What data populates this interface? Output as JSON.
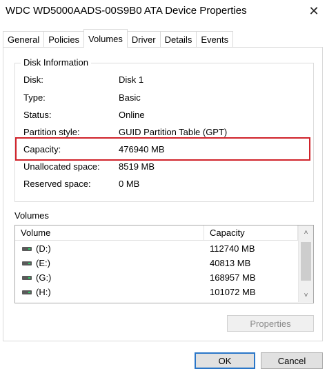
{
  "window": {
    "title": "WDC WD5000AADS-00S9B0 ATA Device Properties",
    "close_glyph": "✕"
  },
  "tabs": [
    {
      "label": "General",
      "active": false
    },
    {
      "label": "Policies",
      "active": false
    },
    {
      "label": "Volumes",
      "active": true
    },
    {
      "label": "Driver",
      "active": false
    },
    {
      "label": "Details",
      "active": false
    },
    {
      "label": "Events",
      "active": false
    }
  ],
  "disk_info": {
    "legend": "Disk Information",
    "rows": [
      {
        "label": "Disk:",
        "value": "Disk 1"
      },
      {
        "label": "Type:",
        "value": "Basic"
      },
      {
        "label": "Status:",
        "value": "Online"
      },
      {
        "label": "Partition style:",
        "value": "GUID Partition Table (GPT)"
      },
      {
        "label": "Capacity:",
        "value": "476940 MB"
      },
      {
        "label": "Unallocated space:",
        "value": "8519 MB"
      },
      {
        "label": "Reserved space:",
        "value": "0 MB"
      }
    ],
    "highlight_color": "#d0222a"
  },
  "volumes": {
    "label": "Volumes",
    "columns": [
      "Volume",
      "Capacity"
    ],
    "rows": [
      {
        "volume": "(D:)",
        "capacity": "112740 MB",
        "icon": "drive-icon"
      },
      {
        "volume": "(E:)",
        "capacity": "40813 MB",
        "icon": "drive-icon"
      },
      {
        "volume": "(G:)",
        "capacity": "168957 MB",
        "icon": "drive-icon"
      },
      {
        "volume": "(H:)",
        "capacity": "101072 MB",
        "icon": "drive-icon"
      }
    ],
    "scroll_up_glyph": "˄",
    "scroll_down_glyph": "˅",
    "properties_label": "Properties",
    "properties_enabled": false
  },
  "buttons": {
    "ok_label": "OK",
    "cancel_label": "Cancel",
    "ok_border_color": "#2a76c8"
  }
}
